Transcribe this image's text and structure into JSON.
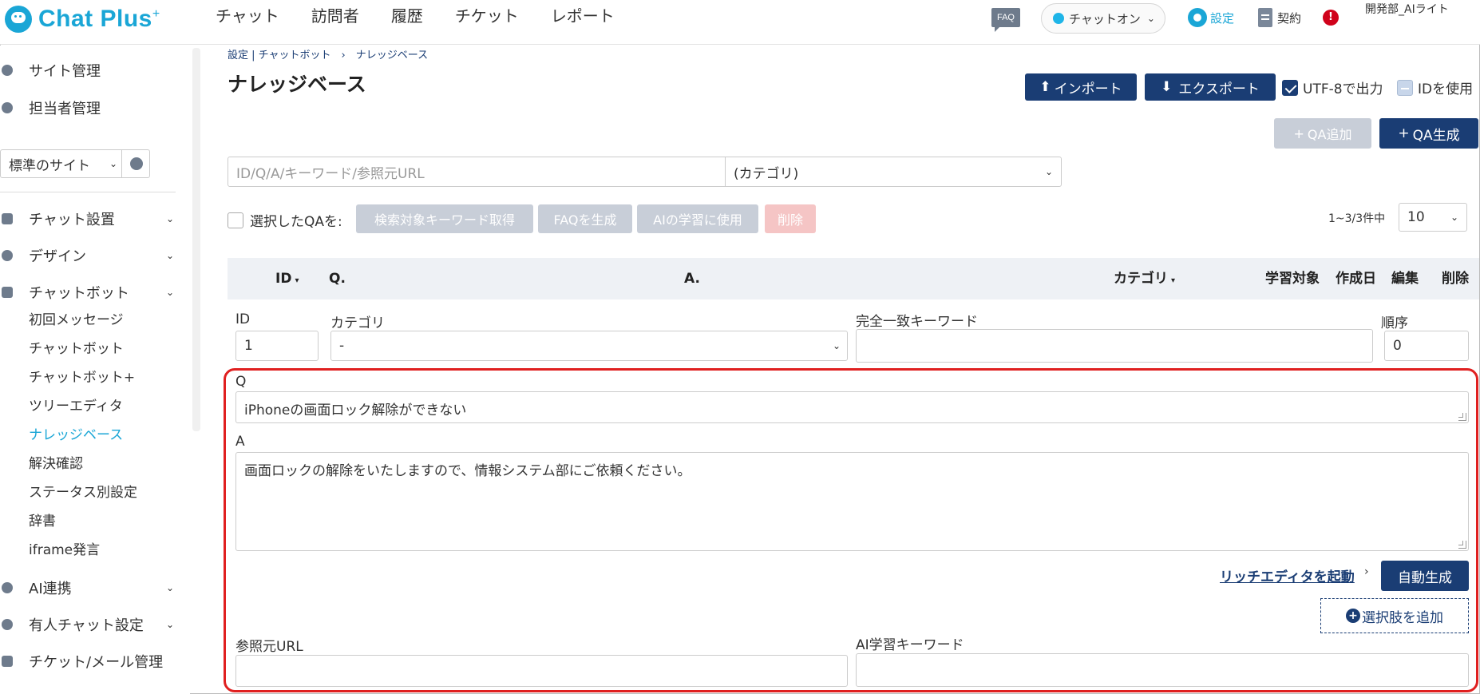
{
  "app": {
    "logo_text": "Chat Plus",
    "logo_sup": "+"
  },
  "nav": {
    "items": [
      "チャット",
      "訪問者",
      "履歴",
      "チケット",
      "レポート"
    ]
  },
  "header": {
    "faq_label": "FAQ",
    "status_label": "チャットオン",
    "settings_label": "設定",
    "contract_label": "契約",
    "alert_mark": "!",
    "user_name": "開発部_AIライト"
  },
  "sidebar": {
    "top_items": [
      "サイト管理",
      "担当者管理"
    ],
    "site_select": "標準のサイト",
    "sections": [
      "チャット設置",
      "デザイン",
      "チャットボット"
    ],
    "chatbot_sub": [
      "初回メッセージ",
      "チャットボット",
      "チャットボット+",
      "ツリーエディタ",
      "ナレッジベース",
      "解決確認",
      "ステータス別設定",
      "辞書",
      "iframe発言"
    ],
    "active_sub": "ナレッジベース",
    "bottom_sections": [
      "AI連携",
      "有人チャット設定",
      "チケット/メール管理"
    ]
  },
  "page": {
    "breadcrumb": "設定 | チャットボット　›　ナレッジベース",
    "title": "ナレッジベース",
    "import_label": "インポート",
    "export_label": "エクスポート",
    "utf8_label": "UTF-8で出力",
    "use_id_label": "IDを使用",
    "qa_add_label": "QA追加",
    "qa_generate_label": "QA生成"
  },
  "search": {
    "placeholder": "ID/Q/A/キーワード/参照元URL",
    "category_value": "(カテゴリ)"
  },
  "bulk": {
    "label": "選択したQAを:",
    "actions": [
      "検索対象キーワード取得",
      "FAQを生成",
      "AIの学習に使用",
      "削除"
    ]
  },
  "pagination": {
    "count": "1~3/3件中",
    "per_page": "10"
  },
  "table": {
    "headers": {
      "id": "ID",
      "q": "Q.",
      "a": "A.",
      "category": "カテゴリ",
      "learn": "学習対象",
      "created": "作成日",
      "edit": "編集",
      "delete": "削除"
    }
  },
  "edit": {
    "id_label": "ID",
    "id_value": "1",
    "category_label": "カテゴリ",
    "category_value": "-",
    "exact_keyword_label": "完全一致キーワード",
    "exact_keyword_value": "",
    "order_label": "順序",
    "order_value": "0",
    "q_label": "Q",
    "q_value": "iPhoneの画面ロック解除ができない",
    "a_label": "A",
    "a_value": "画面ロックの解除をいたしますので、情報システム部にご依頼ください。",
    "rich_editor_label": "リッチエディタを起動",
    "auto_generate_label": "自動生成",
    "add_choice_label": "選択肢を追加",
    "ref_url_label": "参照元URL",
    "ref_url_value": "",
    "ai_keyword_label": "AI学習キーワード",
    "ai_keyword_value": ""
  },
  "colors": {
    "brand": "#1aa6d6",
    "navy": "#1a3d74",
    "highlight": "#e02020"
  }
}
